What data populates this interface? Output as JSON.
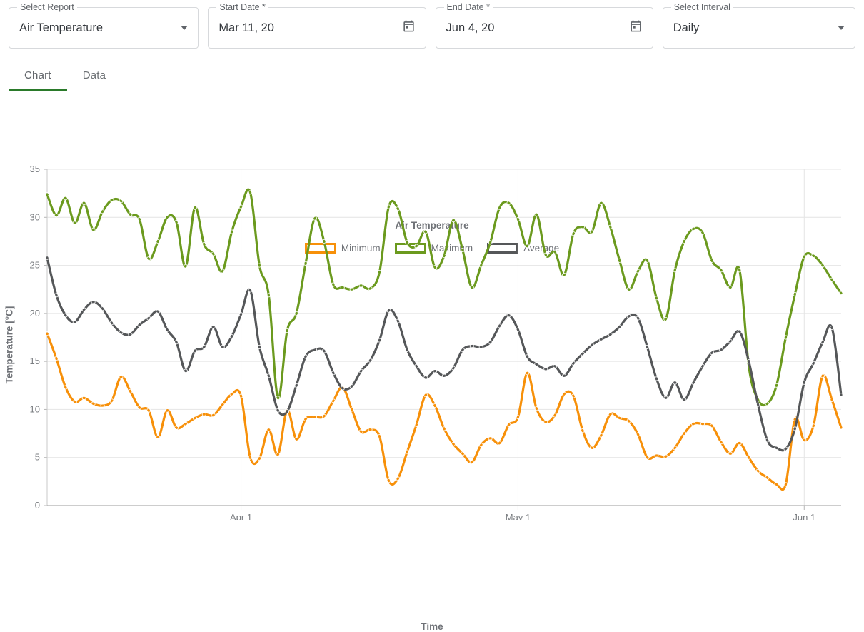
{
  "filters": [
    {
      "key": "report",
      "legend": "Select Report",
      "value": "Air Temperature",
      "control": "select"
    },
    {
      "key": "start",
      "legend": "Start Date *",
      "value": "Mar 11, 20",
      "control": "date"
    },
    {
      "key": "end",
      "legend": "End Date *",
      "value": "Jun 4, 20",
      "control": "date"
    },
    {
      "key": "interval",
      "legend": "Select Interval",
      "value": "Daily",
      "control": "select"
    }
  ],
  "filter_labels": {
    "report_legend": "Select Report",
    "report_value": "Air Temperature",
    "start_legend": "Start Date *",
    "start_value": "Mar 11, 20",
    "end_legend": "End Date *",
    "end_value": "Jun 4, 20",
    "interval_legend": "Select Interval",
    "interval_value": "Daily"
  },
  "tabs": [
    {
      "label": "Chart",
      "active": true
    },
    {
      "label": "Data",
      "active": false
    }
  ],
  "tab_labels": {
    "chart": "Chart",
    "data": "Data"
  },
  "icons": {
    "report_caret": "chevron-down-icon",
    "interval_caret": "chevron-down-icon",
    "start_calendar": "calendar-icon",
    "end_calendar": "calendar-icon"
  },
  "colors": {
    "minimum": "#F79009",
    "maximum": "#6B9A1E",
    "average": "#555759",
    "accent": "#2a7a2a",
    "grid": "#e4e4e4",
    "axis": "#9b9b9b",
    "text": "#6f7277"
  },
  "chart_data": {
    "type": "line",
    "title": "Air Temperature",
    "xlabel": "Time",
    "ylabel": "Temperature [°C]",
    "ylim": [
      0,
      35
    ],
    "yticks": [
      0,
      5,
      10,
      15,
      20,
      25,
      30,
      35
    ],
    "ytick_labels": [
      "0",
      "5",
      "10",
      "15",
      "20",
      "25",
      "30",
      "35"
    ],
    "xtick_labels": [
      "Apr 1",
      "May 1",
      "Jun 1"
    ],
    "xtick_indices": [
      21,
      51,
      82
    ],
    "grid": true,
    "legend_position": "top-center",
    "x_start": "Mar 11, 20",
    "x_end": "Jun 4, 20",
    "interval": "Daily",
    "n_points": 86,
    "markers": true,
    "series": [
      {
        "name": "Minimum",
        "color": "#F79009",
        "values": [
          17.9,
          15.3,
          12.3,
          10.8,
          11.2,
          10.6,
          10.4,
          10.9,
          13.4,
          11.9,
          10.2,
          9.9,
          7.1,
          9.9,
          8.1,
          8.5,
          9.1,
          9.5,
          9.4,
          10.5,
          11.6,
          11.4,
          5.0,
          4.9,
          7.9,
          5.3,
          9.9,
          6.9,
          9.0,
          9.2,
          9.3,
          10.9,
          12.3,
          10.0,
          7.7,
          7.9,
          7.2,
          2.6,
          2.8,
          5.6,
          8.4,
          11.5,
          10.4,
          8.0,
          6.4,
          5.4,
          4.5,
          6.3,
          7.0,
          6.5,
          8.4,
          9.2,
          13.8,
          10.1,
          8.7,
          9.4,
          11.6,
          11.4,
          7.8,
          6.0,
          7.3,
          9.5,
          9.1,
          8.8,
          7.4,
          5.0,
          5.2,
          5.1,
          6.0,
          7.5,
          8.5,
          8.5,
          8.3,
          6.6,
          5.4,
          6.5,
          5.0,
          3.6,
          2.9,
          2.2,
          2.2,
          9.0,
          6.8,
          8.3,
          13.5,
          11.0,
          8.1
        ]
      },
      {
        "name": "Maximum",
        "color": "#6B9A1E",
        "values": [
          32.4,
          30.2,
          32.0,
          29.4,
          31.5,
          28.7,
          30.6,
          31.8,
          31.7,
          30.3,
          29.8,
          25.7,
          27.5,
          30.0,
          29.5,
          24.9,
          31.0,
          27.2,
          26.2,
          24.4,
          28.5,
          31.1,
          32.6,
          25.0,
          21.9,
          11.2,
          18.2,
          20.0,
          25.2,
          29.9,
          27.5,
          23.0,
          22.7,
          22.5,
          22.9,
          22.6,
          24.3,
          31.1,
          30.9,
          27.4,
          27.0,
          28.5,
          24.8,
          26.0,
          29.7,
          26.6,
          22.7,
          25.0,
          27.4,
          31.0,
          31.5,
          29.8,
          27.0,
          30.3,
          26.1,
          26.4,
          24.0,
          28.3,
          29.0,
          28.5,
          31.5,
          29.0,
          25.5,
          22.5,
          24.4,
          25.5,
          21.6,
          19.4,
          24.5,
          27.5,
          28.8,
          28.4,
          25.5,
          24.5,
          22.7,
          24.5,
          14.5,
          11.0,
          10.6,
          12.5,
          17.5,
          22.0,
          25.9,
          26.0,
          25.0,
          23.5,
          22.1
        ]
      },
      {
        "name": "Average",
        "color": "#555759",
        "values": [
          25.8,
          21.9,
          19.8,
          19.1,
          20.4,
          21.2,
          20.5,
          19.0,
          18.0,
          17.8,
          18.8,
          19.5,
          20.2,
          18.3,
          17.0,
          14.0,
          16.1,
          16.5,
          18.6,
          16.5,
          17.6,
          19.9,
          22.4,
          16.5,
          13.5,
          9.9,
          9.8,
          12.5,
          15.5,
          16.2,
          16.1,
          13.8,
          12.2,
          12.4,
          14.0,
          15.1,
          17.2,
          20.3,
          19.2,
          16.2,
          14.5,
          13.3,
          14.0,
          13.5,
          14.3,
          16.2,
          16.6,
          16.5,
          17.0,
          18.7,
          19.8,
          18.3,
          15.5,
          14.7,
          14.2,
          14.5,
          13.5,
          14.8,
          15.8,
          16.7,
          17.3,
          17.8,
          18.6,
          19.7,
          19.5,
          16.5,
          13.2,
          11.2,
          12.8,
          11.0,
          12.8,
          14.5,
          15.9,
          16.2,
          17.1,
          18.1,
          15.0,
          10.5,
          6.8,
          6.0,
          5.9,
          8.0,
          12.8,
          14.8,
          17.0,
          18.5,
          11.5
        ]
      }
    ]
  }
}
